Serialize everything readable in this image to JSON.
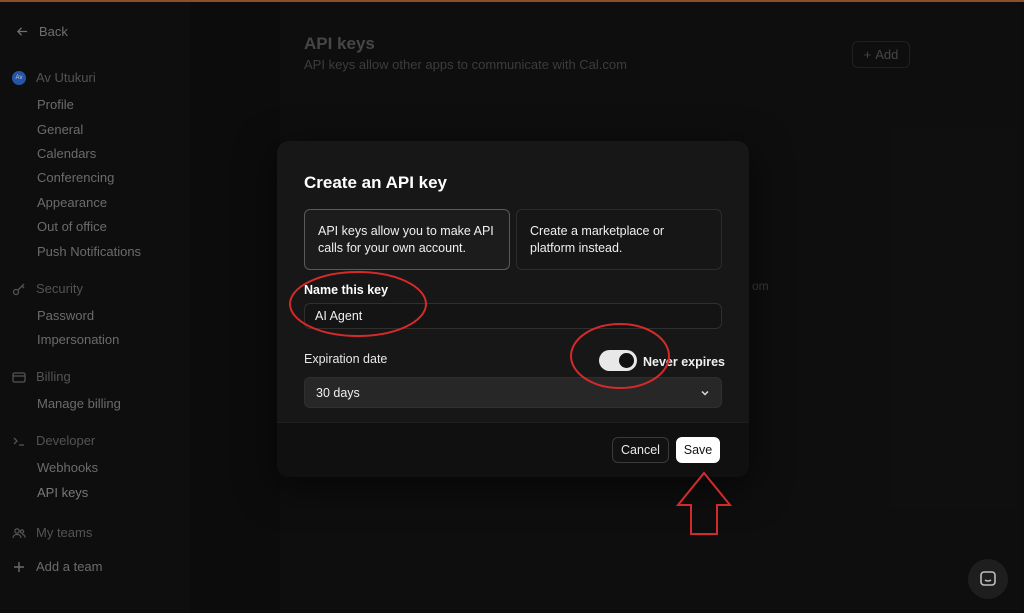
{
  "sidebar": {
    "back_label": "Back",
    "user": {
      "name": "Av Utukuri",
      "avatar_initials": "Av"
    },
    "account_items": [
      "Profile",
      "General",
      "Calendars",
      "Conferencing",
      "Appearance",
      "Out of office",
      "Push Notifications"
    ],
    "security": {
      "label": "Security",
      "items": [
        "Password",
        "Impersonation"
      ]
    },
    "billing": {
      "label": "Billing",
      "items": [
        "Manage billing"
      ]
    },
    "developer": {
      "label": "Developer",
      "items": [
        "Webhooks",
        "API keys"
      ]
    },
    "teams": {
      "label": "My teams"
    },
    "add_team": "Add a team"
  },
  "page": {
    "title": "API keys",
    "subtitle": "API keys allow other apps to communicate with Cal.com",
    "add_label": "Add",
    "partial_text": "om"
  },
  "modal": {
    "title": "Create an API key",
    "option_personal": "API keys allow you to make API calls for your own account.",
    "option_marketplace": "Create a marketplace or platform instead.",
    "name_label": "Name this key",
    "name_value": "AI Agent",
    "expiration_label": "Expiration date",
    "never_expires_label": "Never expires",
    "never_expires_on": true,
    "expiration_value": "30 days",
    "cancel_label": "Cancel",
    "save_label": "Save"
  },
  "colors": {
    "annotation_red": "#d42a2a",
    "primary_button": "#ffffff",
    "modal_bg": "#171717"
  }
}
